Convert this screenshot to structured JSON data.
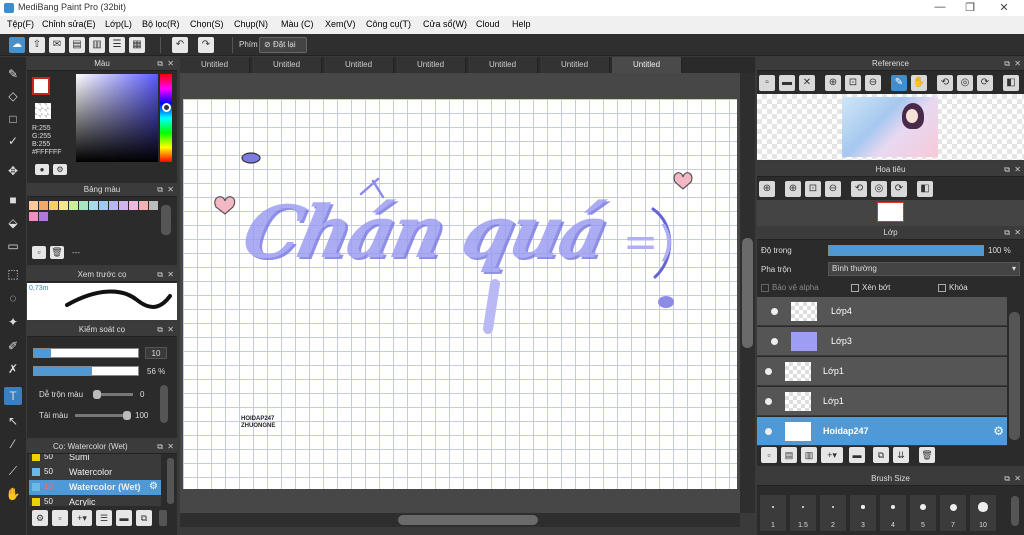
{
  "window": {
    "title": "MediBang Paint Pro (32bit)",
    "minimize": "—",
    "maximize": "❐",
    "close": "✕"
  },
  "menu": [
    "Tệp(F)",
    "Chỉnh sửa(E)",
    "Lớp(L)",
    "Bộ lọc(R)",
    "Chọn(S)",
    "Chụp(N)",
    "Màu (C)",
    "Xem(V)",
    "Công cụ(T)",
    "Cửa sổ(W)",
    "Cloud",
    "Help"
  ],
  "toolbar": {
    "hotkey_label": "Phím",
    "reset_label": "Đặt lại"
  },
  "tabs": [
    "Untitled",
    "Untitled",
    "Untitled",
    "Untitled",
    "Untitled",
    "Untitled",
    "Untitled"
  ],
  "color_panel": {
    "title": "Màu",
    "r": "R:255",
    "g": "G:255",
    "b": "B:255",
    "hex": "#FFFFFF",
    "accent": "#cc2222"
  },
  "swatch_panel": {
    "title": "Bảng màu",
    "placeholder": "---",
    "colors": [
      "#f7c9a0",
      "#f3a86a",
      "#f5d06a",
      "#f4e98a",
      "#c9f0a0",
      "#a8e6c2",
      "#a7dde8",
      "#a5c8f0",
      "#b8b8f0",
      "#d3b5ee",
      "#f0b8df",
      "#f3b0b5",
      "#bbbbbb",
      "#ee8fbf",
      "#b07ad8"
    ]
  },
  "preview_panel": {
    "title": "Xem trước cọ",
    "size": "0,73m"
  },
  "control_panel": {
    "title": "Kiểm soát cọ",
    "size": "10",
    "opacity": "56 %",
    "blend_label": "Dễ trộn màu",
    "blend_value": "0",
    "load_label": "Tải màu",
    "load_value": "100"
  },
  "brush_panel": {
    "title": "Cọ: Watercolor (Wet)",
    "items": [
      {
        "num": "50",
        "name": "Sumi",
        "color": "#f0d000",
        "num_color": "#eeeeee",
        "selected": false
      },
      {
        "num": "50",
        "name": "Watercolor",
        "color": "#6cb8e6",
        "num_color": "#eeeeee",
        "selected": false
      },
      {
        "num": "10",
        "name": "Watercolor (Wet)",
        "color": "#6cb8e6",
        "num_color": "#ff6b6b",
        "selected": true
      },
      {
        "num": "50",
        "name": "Acrylic",
        "color": "#f0d000",
        "num_color": "#eeeeee",
        "selected": false
      }
    ]
  },
  "canvas": {
    "text": "Chán quá",
    "smiley": "=)",
    "watermark_1": "HOIDAP247",
    "watermark_2": "ZHUONGNE",
    "ink": "#8b8bf0",
    "ink_dark": "#6464d8"
  },
  "reference_panel": {
    "title": "Reference"
  },
  "navigator_panel": {
    "title": "Hoa tiêu"
  },
  "layer_panel": {
    "title": "Lớp",
    "opacity_label": "Độ trong",
    "opacity_value": "100 %",
    "opacity": 1.0,
    "blend_label": "Pha trộn",
    "blend_value": "Bình thường",
    "protect_alpha": "Bảo vệ alpha",
    "clipping": "Xén bớt",
    "lock": "Khóa",
    "layers": [
      {
        "name": "Lớp4",
        "selected": false,
        "indent": true
      },
      {
        "name": "Lớp3",
        "selected": false,
        "indent": true
      },
      {
        "name": "Lớp1",
        "selected": false,
        "indent": false
      },
      {
        "name": "Lớp1",
        "selected": false,
        "indent": false
      },
      {
        "name": "Hoidap247",
        "selected": true,
        "indent": false
      }
    ]
  },
  "brush_size_panel": {
    "title": "Brush Size",
    "sizes": [
      "1",
      "1.5",
      "2",
      "3",
      "4",
      "5",
      "7",
      "10"
    ]
  }
}
